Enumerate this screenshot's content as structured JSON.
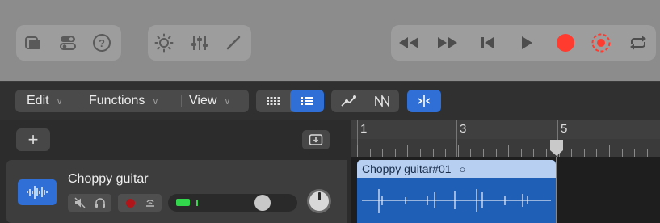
{
  "toolbar": {
    "left_icons": [
      "library-icon",
      "toggle-icon",
      "help-icon"
    ],
    "help_glyph": "?",
    "mid_icons": [
      "brightness-icon",
      "mixer-icon",
      "pencil-icon"
    ],
    "transport_icons": [
      "rewind-icon",
      "fast-forward-icon",
      "go-to-start-icon",
      "play-icon",
      "record-icon",
      "capture-record-icon",
      "cycle-icon"
    ],
    "record_color": "#ff3b30"
  },
  "menubar": {
    "edit_label": "Edit",
    "functions_label": "Functions",
    "view_label": "View",
    "caret": "∨"
  },
  "tracks": {
    "add_glyph": "+",
    "items": [
      {
        "name": "Choppy guitar",
        "volume_level": 0.78,
        "meter_level": 0.25
      }
    ]
  },
  "ruler": {
    "bars": [
      "1",
      "3",
      "5"
    ],
    "playhead_bar": 5
  },
  "region": {
    "title": "Choppy guitar#01",
    "loop_glyph": "○"
  },
  "colors": {
    "accent": "#2f6fd6",
    "region": "#1f5fb5",
    "region_header": "#b7cff0",
    "meter": "#32d74b"
  }
}
